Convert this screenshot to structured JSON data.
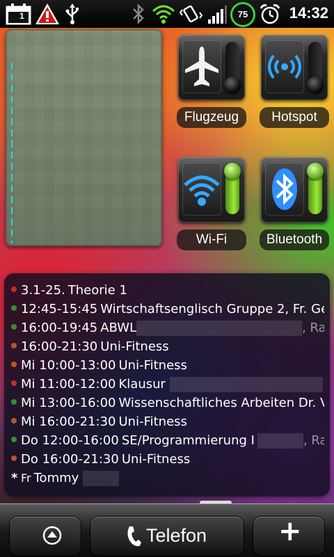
{
  "status_bar": {
    "calendar_notification_day": "1",
    "battery_level": "75",
    "time": "14:32",
    "icons": [
      "calendar-icon",
      "warning-icon",
      "usb-icon",
      "bluetooth-icon",
      "wifi-icon",
      "vibrate-icon",
      "signal-icon",
      "battery-icon",
      "alarm-icon"
    ]
  },
  "toggles": [
    {
      "label": "Flugzeug",
      "icon": "airplane-icon",
      "state": "off"
    },
    {
      "label": "Hotspot",
      "icon": "hotspot-icon",
      "state": "off"
    },
    {
      "label": "Wi-Fi",
      "icon": "wifi-icon",
      "state": "on"
    },
    {
      "label": "Bluetooth",
      "icon": "bluetooth-icon",
      "state": "on"
    }
  ],
  "calendar": {
    "events": [
      {
        "dot_color": "#c0302a",
        "time": "3.1-25.",
        "title": "Theorie 1",
        "tail": ""
      },
      {
        "dot_color": "#3c8c30",
        "time": "12:45-15:45",
        "title": "Wirtschaftsenglisch Gruppe 2, Fr. Ge",
        "tail": ""
      },
      {
        "dot_color": "#3c8c30",
        "time": "16:00-19:45",
        "title": "ABWL",
        "tail": ", Ra"
      },
      {
        "dot_color": "#b5562a",
        "time": "16:00-21:30",
        "title": "Uni-Fitness",
        "tail": ""
      },
      {
        "dot_color": "#b5562a",
        "time": "Mi 10:00-13:00",
        "title": "Uni-Fitness",
        "tail": ""
      },
      {
        "dot_color": "#c0302a",
        "time": "Mi 11:00-12:00",
        "title": "Klausur",
        "tail": ""
      },
      {
        "dot_color": "#3c8c30",
        "time": "Mi 13:00-16:00",
        "title": "Wissenschaftliches Arbeiten Dr. V",
        "tail": ""
      },
      {
        "dot_color": "#b5562a",
        "time": "Mi 16:00-21:30",
        "title": "Uni-Fitness",
        "tail": ""
      },
      {
        "dot_color": "#3c8c30",
        "time": "Do 12:00-16:00",
        "title": "SE/Programmierung I",
        "tail": ", Ra"
      },
      {
        "dot_color": "#b5562a",
        "time": "Do 16:00-21:30",
        "title": "Uni-Fitness",
        "tail": ""
      },
      {
        "marker": "*",
        "time": "Fr",
        "title": "Tommy",
        "tail": ""
      }
    ]
  },
  "dock": {
    "phone_label": "Telefon"
  },
  "colors": {
    "battery_ring": "#3bd13b",
    "toggle_on": "#9be93a",
    "calendar_bg": "#100e20"
  }
}
